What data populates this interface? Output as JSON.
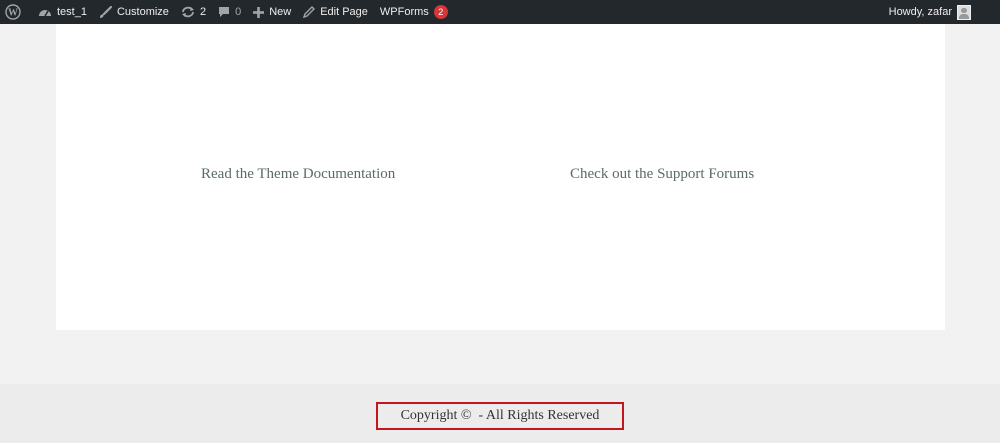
{
  "adminbar": {
    "site_name": "test_1",
    "customize_label": "Customize",
    "updates_count": "2",
    "comments_count": "0",
    "new_label": "New",
    "edit_page_label": "Edit Page",
    "wpforms_label": "WPForms",
    "wpforms_badge": "2",
    "greeting": "Howdy, zafar"
  },
  "content": {
    "links": [
      "Read the Theme Documentation",
      "Check out the Support Forums"
    ]
  },
  "footer": {
    "copyright": "Copyright ©  - All Rights Reserved"
  },
  "colors": {
    "adminbar_bg": "#23282d",
    "badge": "#d63638",
    "highlight_border": "#c4161c",
    "link_text": "#5a6b6b"
  }
}
